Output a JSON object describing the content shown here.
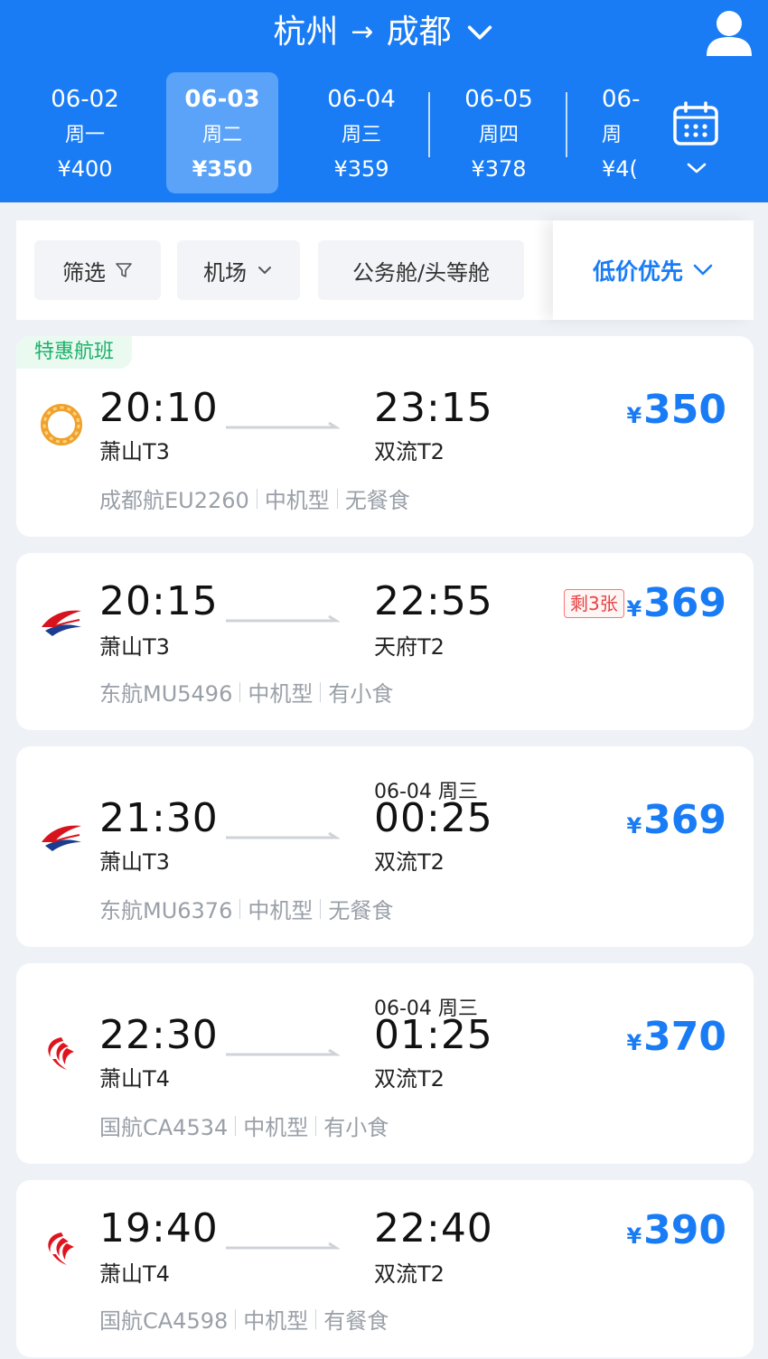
{
  "header": {
    "from": "杭州",
    "arrow": "→",
    "to": "成都"
  },
  "dates": [
    {
      "date": "06-02",
      "weekday": "周一",
      "price": "¥400",
      "active": false
    },
    {
      "date": "06-03",
      "weekday": "周二",
      "price": "¥350",
      "active": true
    },
    {
      "date": "06-04",
      "weekday": "周三",
      "price": "¥359",
      "active": false
    },
    {
      "date": "06-05",
      "weekday": "周四",
      "price": "¥378",
      "active": false
    },
    {
      "date": "06-",
      "weekday": "周",
      "price": "¥4(",
      "active": false
    }
  ],
  "filters": {
    "filter_label": "筛选",
    "airport_label": "机场",
    "cabin_label": "公务舱/头等舱",
    "sort_label": "低价优先"
  },
  "flights": [
    {
      "tag": "特惠航班",
      "airline_icon": "chengdu-airlines-logo",
      "dep_time": "20:10",
      "dep_airport": "萧山T3",
      "arr_time": "23:15",
      "arr_airport": "双流T2",
      "next_day": "",
      "flight": "成都航EU2260",
      "aircraft": "中机型",
      "meal": "无餐食",
      "remain": "",
      "currency": "¥",
      "price": "350"
    },
    {
      "tag": "",
      "airline_icon": "china-eastern-logo",
      "dep_time": "20:15",
      "dep_airport": "萧山T3",
      "arr_time": "22:55",
      "arr_airport": "天府T2",
      "next_day": "",
      "flight": "东航MU5496",
      "aircraft": "中机型",
      "meal": "有小食",
      "remain": "剩3张",
      "currency": "¥",
      "price": "369"
    },
    {
      "tag": "",
      "airline_icon": "china-eastern-logo",
      "dep_time": "21:30",
      "dep_airport": "萧山T3",
      "arr_time": "00:25",
      "arr_airport": "双流T2",
      "next_day": "06-04 周三",
      "flight": "东航MU6376",
      "aircraft": "中机型",
      "meal": "无餐食",
      "remain": "",
      "currency": "¥",
      "price": "369"
    },
    {
      "tag": "",
      "airline_icon": "air-china-logo",
      "dep_time": "22:30",
      "dep_airport": "萧山T4",
      "arr_time": "01:25",
      "arr_airport": "双流T2",
      "next_day": "06-04 周三",
      "flight": "国航CA4534",
      "aircraft": "中机型",
      "meal": "有小食",
      "remain": "",
      "currency": "¥",
      "price": "370"
    },
    {
      "tag": "",
      "airline_icon": "air-china-logo",
      "dep_time": "19:40",
      "dep_airport": "萧山T4",
      "arr_time": "22:40",
      "arr_airport": "双流T2",
      "next_day": "",
      "flight": "国航CA4598",
      "aircraft": "中机型",
      "meal": "有餐食",
      "remain": "",
      "currency": "¥",
      "price": "390"
    }
  ],
  "colors": {
    "brand_blue": "#1a7cf5",
    "special_green": "#1db06a",
    "remain_red": "#e64242"
  }
}
